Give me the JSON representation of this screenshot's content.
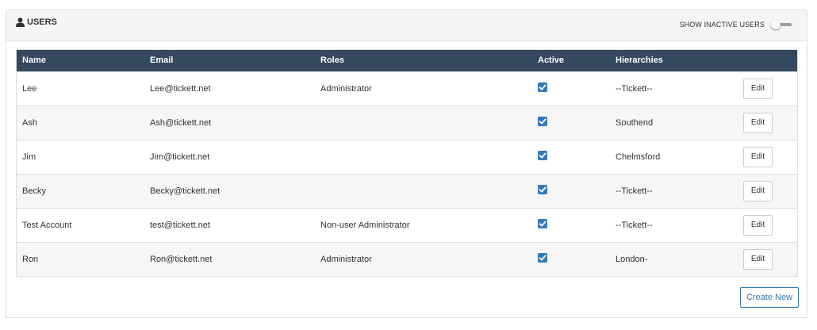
{
  "panel": {
    "title": "USERS",
    "title_icon": "user-icon",
    "toggle_label": "SHOW INACTIVE USERS",
    "toggle_on": false
  },
  "table": {
    "columns": [
      "Name",
      "Email",
      "Roles",
      "Active",
      "Hierarchies",
      ""
    ],
    "rows": [
      {
        "name": "Lee",
        "email": "Lee@tickett.net",
        "roles": "Administrator",
        "active": true,
        "hierarchy": "--Tickett--",
        "action": "Edit"
      },
      {
        "name": "Ash",
        "email": "Ash@tickett.net",
        "roles": "",
        "active": true,
        "hierarchy": "Southend",
        "action": "Edit"
      },
      {
        "name": "Jim",
        "email": "Jim@tickett.net",
        "roles": "",
        "active": true,
        "hierarchy": "Chelmsford",
        "action": "Edit"
      },
      {
        "name": "Becky",
        "email": "Becky@tickett.net",
        "roles": "",
        "active": true,
        "hierarchy": "--Tickett--",
        "action": "Edit"
      },
      {
        "name": "Test Account",
        "email": "test@tickett.net",
        "roles": "Non-user Administrator",
        "active": true,
        "hierarchy": "--Tickett--",
        "action": "Edit"
      },
      {
        "name": "Ron",
        "email": "Ron@tickett.net",
        "roles": "Administrator",
        "active": true,
        "hierarchy": "London-",
        "action": "Edit"
      }
    ]
  },
  "footer": {
    "create_label": "Create New"
  },
  "colors": {
    "header_bg": "#34495e",
    "accent": "#3379b7",
    "row_alt": "#f6f6f6"
  }
}
